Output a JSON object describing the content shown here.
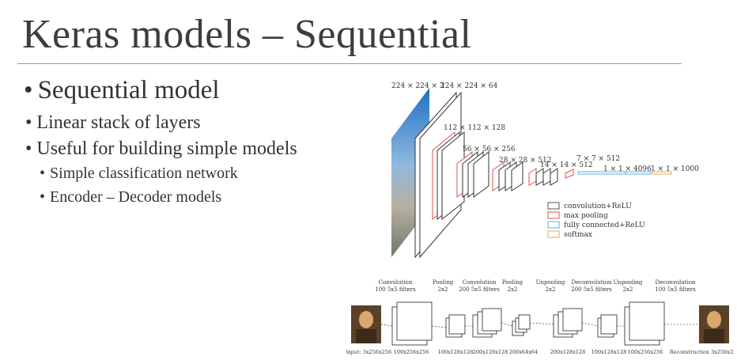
{
  "slide": {
    "title": "Keras models – Sequential",
    "bullets": [
      {
        "text": "Sequential model"
      },
      {
        "text": "Linear stack of layers"
      },
      {
        "text": "Useful for building simple models"
      },
      {
        "text": "Simple classification network"
      },
      {
        "text": "Encoder – Decoder models"
      }
    ]
  },
  "vgg": {
    "dims": [
      "224 × 224 × 3",
      "224 × 224 × 64",
      "112 × 112 × 128",
      "56 × 56 × 256",
      "28 × 28 × 512",
      "14 × 14 × 512",
      "7 × 7 × 512",
      "1 × 1 × 4096",
      "1 × 1 × 1000"
    ],
    "legend": [
      "convolution+ReLU",
      "max pooling",
      "fully connected+ReLU",
      "softmax"
    ],
    "colors": {
      "conv": "#555555",
      "pool": "#e0504a",
      "fc": "#4fb3e0",
      "softmax": "#e8a94a"
    }
  },
  "segnet": {
    "ops": [
      [
        "Convolution",
        "100 5x5 filters"
      ],
      [
        "Pooling",
        "2x2"
      ],
      [
        "Convolution",
        "200 5x5 filters"
      ],
      [
        "Pooling",
        "2x2"
      ],
      [
        "Unpooling",
        "2x2"
      ],
      [
        "Deconvolution",
        "200 5x5 filters"
      ],
      [
        "Unpooling",
        "2x2"
      ],
      [
        "Deconvolution",
        "100 5x5 filters"
      ]
    ],
    "sizes": [
      "Input: 3x256x256",
      "100x256x256",
      "100x128x128",
      "200x128x128",
      "200x64x64",
      "200x128x128",
      "100x128x128",
      "100x256x256",
      "Reconstruction 3x256x256"
    ]
  }
}
